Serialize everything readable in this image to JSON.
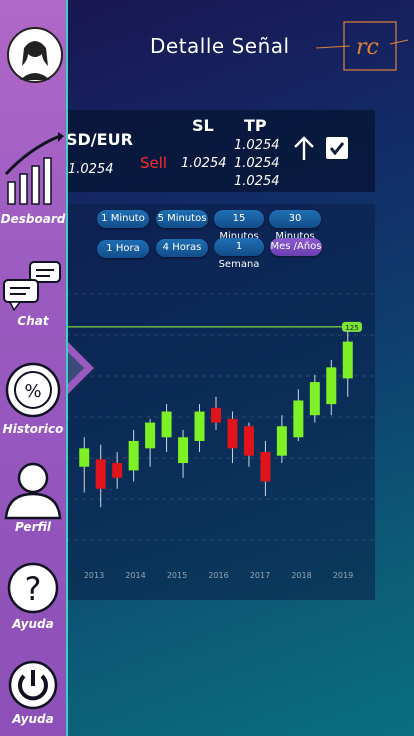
{
  "header": {
    "title": "Detalle Señal",
    "logo_text": "rc"
  },
  "signal": {
    "pair": "SD/EUR",
    "pair_value": "1.0254",
    "action": "Sell",
    "sl_header": "SL",
    "sl_value": "1.0254",
    "tp_header": "TP",
    "tp_values": [
      "1.0254",
      "1.0254",
      "1.0254"
    ],
    "direction_icon": "arrow-up-icon",
    "checked": true
  },
  "timeframes": {
    "row1": [
      "1 Minuto",
      "5 Minutos",
      "15 Minutos",
      "30 Minutos"
    ],
    "row2": [
      "1 Hora",
      "4 Horas",
      "1 Semana",
      "Mes /Años"
    ],
    "active": "Mes /Años"
  },
  "sidebar": {
    "items": [
      {
        "label": "",
        "icon": "avatar-icon"
      },
      {
        "label": "Desboard",
        "icon": "chart-growth-icon"
      },
      {
        "label": "Chat",
        "icon": "chat-icon"
      },
      {
        "label": "Historico",
        "icon": "percent-icon"
      },
      {
        "label": "Perfil",
        "icon": "user-icon"
      },
      {
        "label": "Ayuda",
        "icon": "question-icon"
      },
      {
        "label": "Ayuda",
        "icon": "power-icon"
      }
    ]
  },
  "chart_data": {
    "type": "candlestick",
    "x_ticks": [
      "2013",
      "2014",
      "2015",
      "2016",
      "2017",
      "2018",
      "2019"
    ],
    "price_tag": "125",
    "ylim": [
      0,
      100
    ],
    "grid": true,
    "candles": [
      {
        "o": 42,
        "h": 58,
        "l": 28,
        "c": 52,
        "up": true
      },
      {
        "o": 46,
        "h": 54,
        "l": 20,
        "c": 30,
        "up": false
      },
      {
        "o": 44,
        "h": 50,
        "l": 30,
        "c": 36,
        "up": false
      },
      {
        "o": 40,
        "h": 62,
        "l": 34,
        "c": 56,
        "up": true
      },
      {
        "o": 52,
        "h": 68,
        "l": 42,
        "c": 66,
        "up": true
      },
      {
        "o": 58,
        "h": 76,
        "l": 50,
        "c": 72,
        "up": true
      },
      {
        "o": 44,
        "h": 62,
        "l": 36,
        "c": 58,
        "up": true
      },
      {
        "o": 56,
        "h": 76,
        "l": 50,
        "c": 72,
        "up": true
      },
      {
        "o": 74,
        "h": 80,
        "l": 62,
        "c": 66,
        "up": false
      },
      {
        "o": 68,
        "h": 72,
        "l": 44,
        "c": 52,
        "up": false
      },
      {
        "o": 64,
        "h": 66,
        "l": 42,
        "c": 48,
        "up": false
      },
      {
        "o": 50,
        "h": 56,
        "l": 26,
        "c": 34,
        "up": false
      },
      {
        "o": 48,
        "h": 70,
        "l": 44,
        "c": 64,
        "up": true
      },
      {
        "o": 58,
        "h": 84,
        "l": 56,
        "c": 78,
        "up": true
      },
      {
        "o": 70,
        "h": 92,
        "l": 66,
        "c": 88,
        "up": true
      },
      {
        "o": 76,
        "h": 100,
        "l": 70,
        "c": 96,
        "up": true
      },
      {
        "o": 90,
        "h": 116,
        "l": 80,
        "c": 110,
        "up": true
      }
    ],
    "reference_line": 118
  }
}
